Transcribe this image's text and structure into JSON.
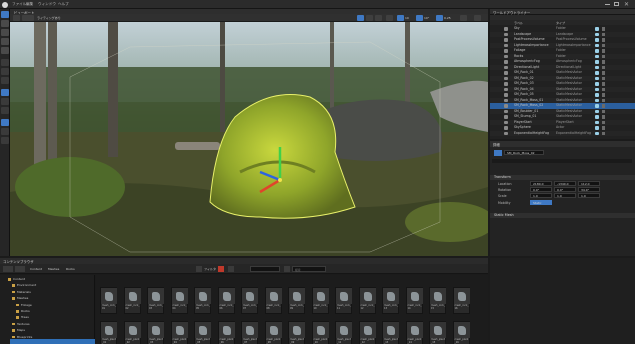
{
  "menu": [
    "ファイル",
    "編集",
    "ウィンドウ",
    "ヘルプ"
  ],
  "viewport": {
    "tab_label": "ビューポート",
    "view_mode": "ライティングあり",
    "grid_snap": "10",
    "rotation_snap": "10°",
    "scale_snap": "0.25"
  },
  "outliner": {
    "title": "ワールドアウトライナー",
    "col_label": "ラベル",
    "col_type": "タイプ",
    "rows": [
      {
        "name": "Sky",
        "type": "Folder",
        "selected": false
      },
      {
        "name": "Landscape",
        "type": "Landscape",
        "selected": false
      },
      {
        "name": "PostProcessVolume",
        "type": "PostProcessVolume",
        "selected": false
      },
      {
        "name": "LightmassImportance",
        "type": "LightmassImportance",
        "selected": false
      },
      {
        "name": "Foliage",
        "type": "Folder",
        "selected": false
      },
      {
        "name": "Rocks",
        "type": "Folder",
        "selected": false
      },
      {
        "name": "AtmosphericFog",
        "type": "AtmosphericFog",
        "selected": false
      },
      {
        "name": "DirectionalLight",
        "type": "DirectionalLight",
        "selected": false
      },
      {
        "name": "SM_Rock_01",
        "type": "StaticMeshActor",
        "selected": false
      },
      {
        "name": "SM_Rock_02",
        "type": "StaticMeshActor",
        "selected": false
      },
      {
        "name": "SM_Rock_03",
        "type": "StaticMeshActor",
        "selected": false
      },
      {
        "name": "SM_Rock_04",
        "type": "StaticMeshActor",
        "selected": false
      },
      {
        "name": "SM_Rock_05",
        "type": "StaticMeshActor",
        "selected": false
      },
      {
        "name": "SM_Rock_Moss_01",
        "type": "StaticMeshActor",
        "selected": false
      },
      {
        "name": "SM_Rock_Moss_02",
        "type": "StaticMeshActor",
        "selected": true
      },
      {
        "name": "SM_Boulder_01",
        "type": "StaticMeshActor",
        "selected": false
      },
      {
        "name": "SM_Stump_01",
        "type": "StaticMeshActor",
        "selected": false
      },
      {
        "name": "PlayerStart",
        "type": "PlayerStart",
        "selected": false
      },
      {
        "name": "SkySphere",
        "type": "Actor",
        "selected": false
      },
      {
        "name": "ExponentialHeightFog",
        "type": "ExponentialHeightFog",
        "selected": false
      }
    ],
    "status": "アクタ 1 個選択済み"
  },
  "details": {
    "title": "詳細",
    "actor_name": "SM_Rock_Moss_02",
    "transform_header": "Transform",
    "location_label": "Location",
    "rotation_label": "Rotation",
    "scale_label": "Scale",
    "mobility_label": "Mobility",
    "location": [
      "2180.0",
      "-1340.0",
      "112.0"
    ],
    "rotation": [
      "0.0°",
      "0.0°",
      "34.0°"
    ],
    "scale": [
      "1.0",
      "1.0",
      "1.0"
    ],
    "mobility": "Static",
    "static_mesh_header": "Static Mesh"
  },
  "content_browser": {
    "tab_label": "コンテンツブラウザ",
    "path": [
      "Content",
      "Meshes",
      "Rocks"
    ],
    "filter_label": "フィルタ",
    "search_placeholder": "検索",
    "tree": [
      "Content",
      "Environment",
      "Materials",
      "Meshes",
      "Foliage",
      "Rocks",
      "Trees",
      "Textures",
      "Maps",
      "Blueprints"
    ],
    "assets": [
      "mesh_rock_01",
      "mesh_rock_02",
      "mesh_rock_03",
      "mesh_rock_04",
      "mesh_rock_05",
      "mesh_rock_06",
      "mesh_rock_07",
      "mesh_rock_08",
      "mesh_rock_09",
      "mesh_rock_10",
      "mesh_rock_11",
      "mesh_rock_12",
      "mesh_rock_13",
      "mesh_rock_14",
      "mesh_rock_15",
      "mesh_rock_16",
      "mesh_plant_01",
      "mesh_plant_02",
      "mesh_plant_03",
      "mesh_plant_04",
      "mesh_plant_05",
      "mesh_plant_06",
      "mesh_plant_07",
      "mesh_plant_08",
      "mesh_plant_09",
      "mesh_plant_10",
      "mesh_plant_11",
      "mesh_plant_12",
      "mesh_plant_13",
      "mesh_plant_14",
      "mesh_plant_15",
      "mesh_plant_16"
    ]
  },
  "colors": {
    "accent": "#2f6fb7",
    "selection": "#2b5f9e",
    "folder": "#c9a045",
    "gizmo_x": "#e0452a",
    "gizmo_y": "#3fd04a",
    "gizmo_z": "#2d63e0"
  }
}
